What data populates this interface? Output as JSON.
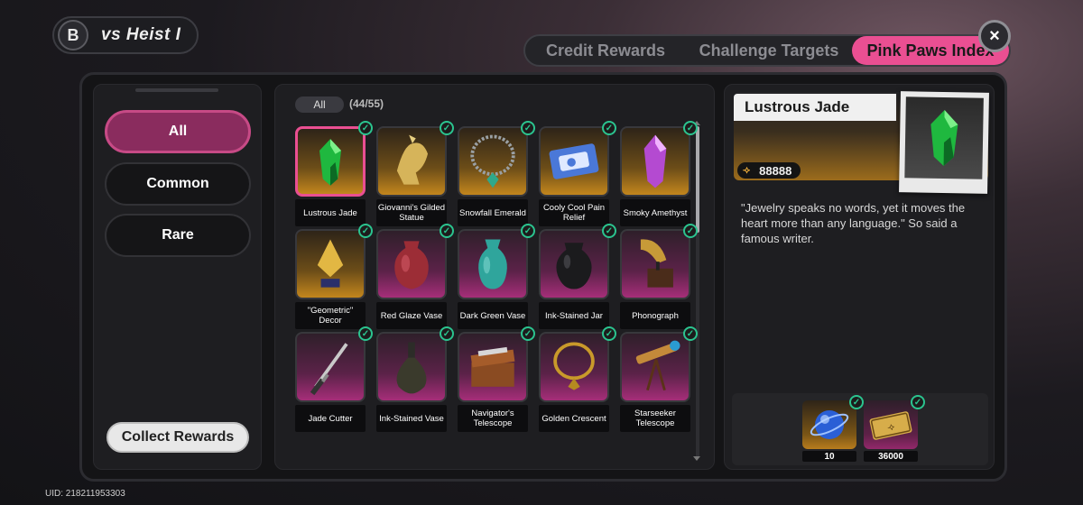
{
  "header": {
    "title": "Heist",
    "title_prefix": "vs ",
    "title_suffix": "I"
  },
  "tabs": [
    {
      "label": "Credit Rewards",
      "active": false
    },
    {
      "label": "Challenge Targets",
      "active": false
    },
    {
      "label": "Pink Paws Index",
      "active": true
    }
  ],
  "close_label": "×",
  "categories": [
    {
      "label": "All",
      "active": true
    },
    {
      "label": "Common",
      "active": false
    },
    {
      "label": "Rare",
      "active": false
    }
  ],
  "collect_label": "Collect Rewards",
  "grid": {
    "filter": "All",
    "count": "(44/55)",
    "items": [
      {
        "name": "Lustrous Jade",
        "bg": "gold",
        "icon": "jade-icon",
        "collected": true,
        "selected": true
      },
      {
        "name": "Giovanni's Gilded Statue",
        "bg": "gold",
        "icon": "statue-icon",
        "collected": true
      },
      {
        "name": "Snowfall Emerald",
        "bg": "gold",
        "icon": "necklace-icon",
        "collected": true
      },
      {
        "name": "Cooly Cool Pain Relief",
        "bg": "gold",
        "icon": "patch-icon",
        "collected": true
      },
      {
        "name": "Smoky Amethyst",
        "bg": "gold",
        "icon": "amethyst-icon",
        "collected": true
      },
      {
        "name": "\"Geometric\" Decor",
        "bg": "gold",
        "icon": "geometric-icon",
        "collected": true
      },
      {
        "name": "Red Glaze Vase",
        "bg": "pink",
        "icon": "red-vase-icon",
        "collected": true
      },
      {
        "name": "Dark Green Vase",
        "bg": "pink",
        "icon": "green-vase-icon",
        "collected": true
      },
      {
        "name": "Ink-Stained Jar",
        "bg": "pink",
        "icon": "jar-icon",
        "collected": true
      },
      {
        "name": "Phonograph",
        "bg": "pink",
        "icon": "phonograph-icon",
        "collected": true
      },
      {
        "name": "Jade Cutter",
        "bg": "pink",
        "icon": "sword-icon",
        "collected": true
      },
      {
        "name": "Ink-Stained Vase",
        "bg": "pink",
        "icon": "flask-icon",
        "collected": true
      },
      {
        "name": "Navigator's Telescope",
        "bg": "pink",
        "icon": "chest-icon",
        "collected": true
      },
      {
        "name": "Golden Crescent",
        "bg": "pink",
        "icon": "pendant-icon",
        "collected": true
      },
      {
        "name": "Starseeker Telescope",
        "bg": "pink",
        "icon": "telescope-icon",
        "collected": true
      }
    ]
  },
  "detail": {
    "name": "Lustrous Jade",
    "value": "88888",
    "description": "\"Jewelry speaks no words, yet it moves the heart more than any language.\" So said a famous writer.",
    "rewards": [
      {
        "qty": "10",
        "icon": "orb-icon",
        "bg": "gold",
        "collected": true
      },
      {
        "qty": "36000",
        "icon": "credit-ticket-icon",
        "bg": "pink",
        "collected": true
      }
    ]
  },
  "footer": {
    "uid": "UID: 218211953303"
  },
  "colors": {
    "accent_pink": "#ea4f92",
    "check_green": "#2bc48f",
    "gold_bg": "#c3861d",
    "rare_bg": "#a62e79"
  }
}
